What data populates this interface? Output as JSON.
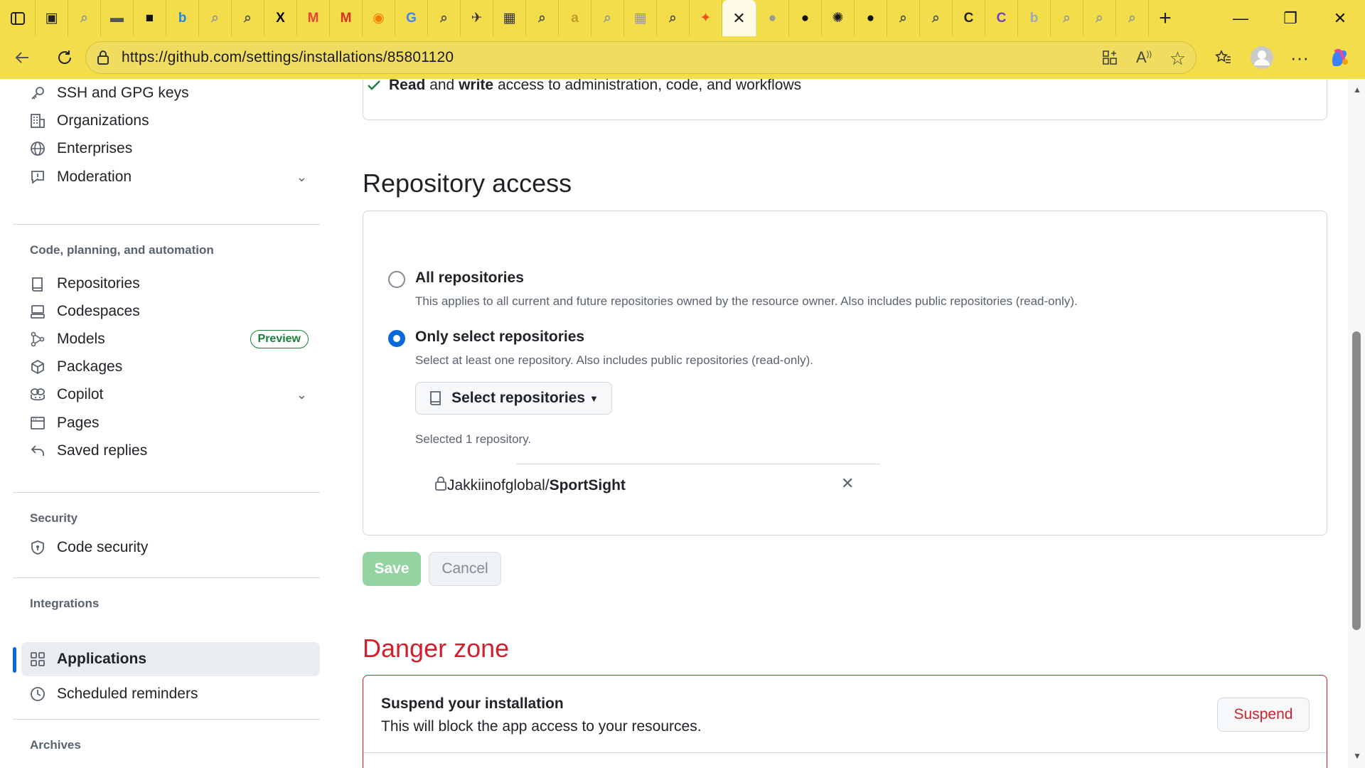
{
  "browser": {
    "url": "https://github.com/settings/installations/85801120",
    "tabs": [
      {
        "icon": "window-icon",
        "color": "#222"
      },
      {
        "icon": "search-icon",
        "color": "#999"
      },
      {
        "icon": "folder-icon",
        "color": "#555"
      },
      {
        "icon": "terminal-icon",
        "color": "#111"
      },
      {
        "icon": "bing-icon",
        "color": "#1e88e5"
      },
      {
        "icon": "search-icon",
        "color": "#999"
      },
      {
        "icon": "search-icon",
        "color": "#555"
      },
      {
        "icon": "x-icon",
        "color": "#000"
      },
      {
        "icon": "gmail-icon",
        "color": "#ea4335"
      },
      {
        "icon": "gmail-icon",
        "color": "#d93025"
      },
      {
        "icon": "circle-icon",
        "color": "#f57c00"
      },
      {
        "icon": "google-icon",
        "color": "#4285f4"
      },
      {
        "icon": "search-icon",
        "color": "#555"
      },
      {
        "icon": "bot-icon",
        "color": "#333"
      },
      {
        "icon": "calendar-icon",
        "color": "#333"
      },
      {
        "icon": "search-icon",
        "color": "#555"
      },
      {
        "icon": "amazon-icon",
        "color": "#c59a2f"
      },
      {
        "icon": "search-icon",
        "color": "#999"
      },
      {
        "icon": "calendar-icon",
        "color": "#999"
      },
      {
        "icon": "search-icon",
        "color": "#555"
      },
      {
        "icon": "figma-icon",
        "color": "#f24e1e"
      }
    ],
    "tabs_after": [
      {
        "icon": "github-icon",
        "color": "#999"
      },
      {
        "icon": "github-icon",
        "color": "#111"
      },
      {
        "icon": "openai-icon",
        "color": "#111"
      },
      {
        "icon": "github-icon",
        "color": "#111"
      },
      {
        "icon": "search-icon",
        "color": "#555"
      },
      {
        "icon": "search-icon",
        "color": "#555"
      },
      {
        "icon": "copilot-app-icon",
        "color": "#222"
      },
      {
        "icon": "copilot-app-icon",
        "color": "#6f42c1"
      },
      {
        "icon": "bing-icon",
        "color": "#9ab"
      },
      {
        "icon": "search-icon",
        "color": "#999"
      },
      {
        "icon": "search-icon",
        "color": "#999"
      },
      {
        "icon": "search-icon",
        "color": "#999"
      }
    ]
  },
  "sidebar": {
    "items_top": [
      {
        "label": "SSH and GPG keys",
        "icon": "key-icon"
      },
      {
        "label": "Organizations",
        "icon": "organization-icon"
      },
      {
        "label": "Enterprises",
        "icon": "globe-icon"
      },
      {
        "label": "Moderation",
        "icon": "report-icon"
      }
    ],
    "heading_code": "Code, planning, and automation",
    "items_code": [
      {
        "label": "Repositories",
        "icon": "repo-icon"
      },
      {
        "label": "Codespaces",
        "icon": "codespaces-icon"
      },
      {
        "label": "Models",
        "icon": "models-icon"
      },
      {
        "label": "Packages",
        "icon": "package-icon"
      },
      {
        "label": "Copilot",
        "icon": "copilot-icon"
      },
      {
        "label": "Pages",
        "icon": "browser-icon"
      },
      {
        "label": "Saved replies",
        "icon": "reply-icon"
      }
    ],
    "models_badge": "Preview",
    "heading_security": "Security",
    "item_security": "Code security",
    "heading_integrations": "Integrations",
    "item_applications": "Applications",
    "item_reminders": "Scheduled reminders",
    "heading_archives": "Archives"
  },
  "permissions": {
    "bold_read": "Read",
    "and": "and",
    "bold_write": "write",
    "rest": "access to administration, code, and workflows"
  },
  "repo_access": {
    "title": "Repository access",
    "all_title": "All repositories",
    "all_desc": "This applies to all current and future repositories owned by the resource owner. Also includes public repositories (read-only).",
    "select_title": "Only select repositories",
    "select_desc": "Select at least one repository. Also includes public repositories (read-only).",
    "select_button": "Select repositories",
    "selected_count": "Selected 1 repository.",
    "repo_owner": "Jakkiinofglobal/",
    "repo_name": "SportSight",
    "save": "Save",
    "cancel": "Cancel"
  },
  "danger": {
    "title": "Danger zone",
    "suspend_title": "Suspend your installation",
    "suspend_desc": "This will block the app access to your resources.",
    "suspend_button": "Suspend"
  },
  "colors": {
    "browser_chrome": "#f4dd4a",
    "accent_blue": "#0969da",
    "danger_red": "#cf222e",
    "save_green_disabled": "#94d3a2"
  }
}
